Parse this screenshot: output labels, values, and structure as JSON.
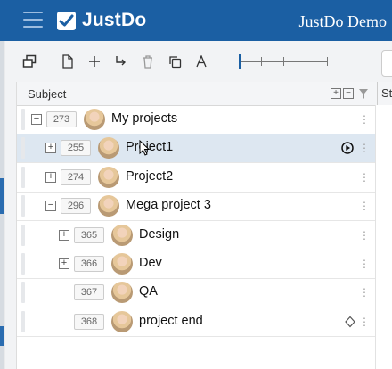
{
  "app": {
    "name": "JustDo",
    "project_name": "JustDo Demo"
  },
  "grid": {
    "columns": {
      "subject": "Subject",
      "status": "Sta"
    },
    "rows": [
      {
        "seq": "273",
        "title": "My projects",
        "toggle": "−",
        "level": 0,
        "selected": false
      },
      {
        "seq": "255",
        "title": "Project1",
        "toggle": "+",
        "level": 1,
        "selected": true,
        "icon": "play-circle-icon"
      },
      {
        "seq": "274",
        "title": "Project2",
        "toggle": "+",
        "level": 1,
        "selected": false
      },
      {
        "seq": "296",
        "title": "Mega project 3",
        "toggle": "−",
        "level": 1,
        "selected": false
      },
      {
        "seq": "365",
        "title": "Design",
        "toggle": "+",
        "level": 2,
        "selected": false
      },
      {
        "seq": "366",
        "title": "Dev",
        "toggle": "+",
        "level": 2,
        "selected": false
      },
      {
        "seq": "367",
        "title": "QA",
        "toggle": "",
        "level": 2,
        "selected": false
      },
      {
        "seq": "368",
        "title": "project end",
        "toggle": "",
        "level": 2,
        "selected": false,
        "icon": "diamond-icon"
      }
    ]
  },
  "colors": {
    "brand": "#1b5fa3",
    "selected_row": "#dde7f1"
  }
}
